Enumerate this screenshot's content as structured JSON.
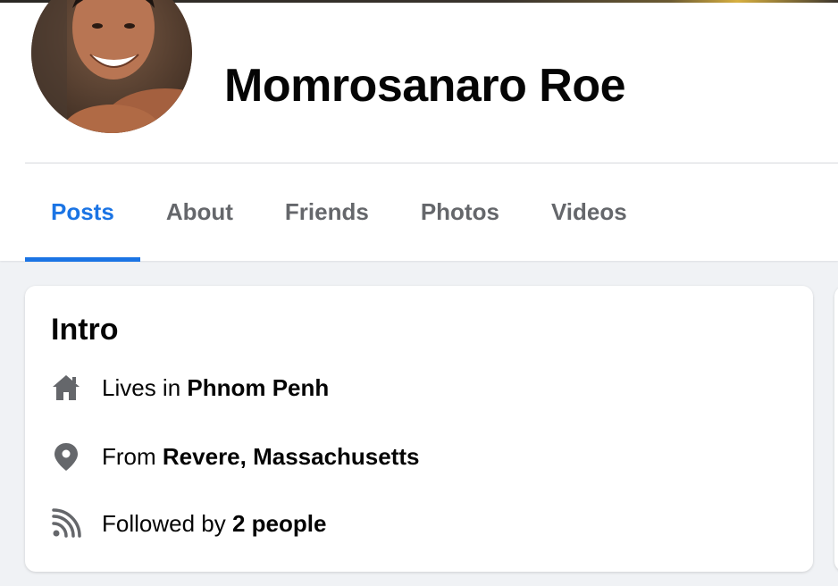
{
  "profile": {
    "name": "Momrosanaro Roe"
  },
  "tabs": [
    {
      "label": "Posts",
      "active": true
    },
    {
      "label": "About",
      "active": false
    },
    {
      "label": "Friends",
      "active": false
    },
    {
      "label": "Photos",
      "active": false
    },
    {
      "label": "Videos",
      "active": false
    }
  ],
  "intro": {
    "title": "Intro",
    "items": [
      {
        "icon": "home-icon",
        "prefix": "Lives in",
        "value": "Phnom Penh"
      },
      {
        "icon": "location-pin-icon",
        "prefix": "From",
        "value": "Revere, Massachusetts"
      },
      {
        "icon": "rss-feed-icon",
        "prefix": "Followed by",
        "value": "2 people"
      }
    ]
  },
  "colors": {
    "accent": "#1b74e4",
    "tab_inactive": "#65676b",
    "icon": "#65676b",
    "page_background": "#f0f2f5",
    "card_background": "#ffffff"
  }
}
